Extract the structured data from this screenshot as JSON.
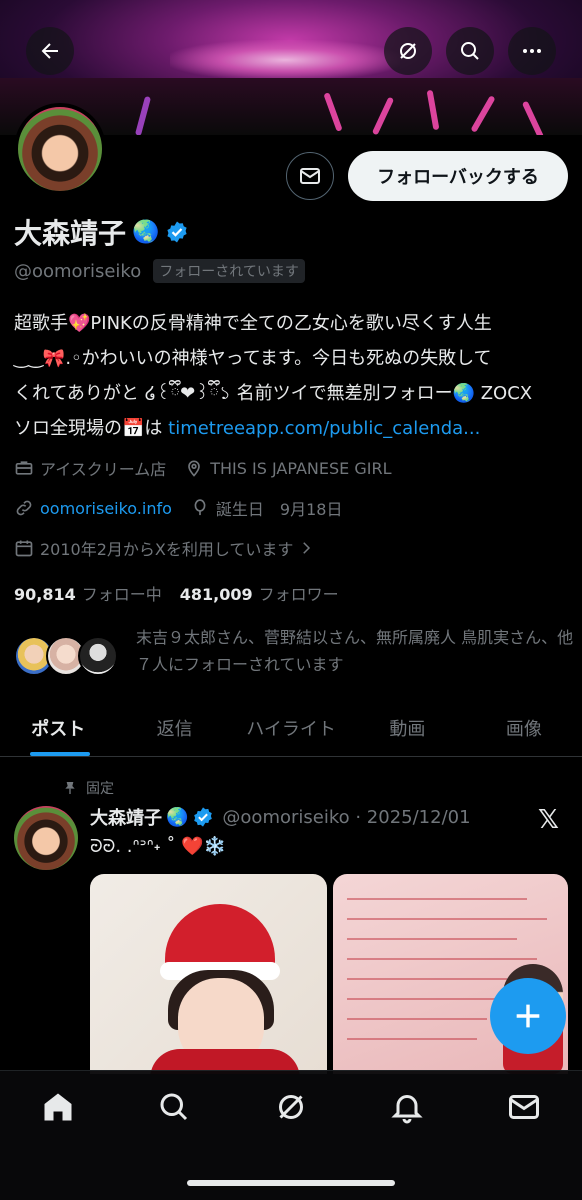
{
  "header": {
    "back_icon": "arrow-left-icon",
    "grok_icon": "grok-icon",
    "search_icon": "search-icon",
    "more_icon": "more-horizontal-icon"
  },
  "profile": {
    "name": "大森靖子",
    "name_emoji": "🌏",
    "handle": "@oomoriseiko",
    "follows_you": "フォローされています",
    "follow_back_label": "フォローバックする",
    "bio_line1": "超歌手💖PINKの反骨精神で全ての乙女心を歌い尽くす人生",
    "bio_line2": "‿‿🎀.◦かわいいの神様ヤってます。今日も死ぬの失敗して",
    "bio_line3": "くれてありがと ໒꒰ྀི❤︎꒱ྀི১ 名前ツイで無差別フォロー🌏 ZOCX",
    "bio_line4_text": "ソロ全現場の📅は ",
    "bio_line4_link": "timetreeapp.com/public_calenda...",
    "category": "アイスクリーム店",
    "location": "THIS IS JAPANESE GIRL",
    "website": "oomoriseiko.info",
    "birthday": "誕生日　9月18日",
    "joined": "2010年2月からXを利用しています",
    "following_count": "90,814",
    "following_label": "フォロー中",
    "followers_count": "481,009",
    "followers_label": "フォロワー",
    "known_followers": "末吉９太郎さん、菅野結以さん、無所属廃人 鳥肌実さん、他７人にフォローされています"
  },
  "tabs": [
    {
      "label": "ポスト",
      "active": true
    },
    {
      "label": "返信",
      "active": false
    },
    {
      "label": "ハイライト",
      "active": false
    },
    {
      "label": "動画",
      "active": false
    },
    {
      "label": "画像",
      "active": false
    }
  ],
  "pinned_post": {
    "pinned_label": "固定",
    "author_name": "大森靖子",
    "author_emoji": "🌏",
    "meta": "@oomoriseiko · 2025/12/01",
    "text": "ᘒᘒ. .ᐢᐣᐢ˖ ˚ ❤️❄️"
  },
  "colors": {
    "accent": "#1d9bf0",
    "background": "#000000",
    "text": "#e7e9ea",
    "muted": "#71767b"
  },
  "bottom_nav": [
    "home-icon",
    "search-icon",
    "grok-icon",
    "notifications-icon",
    "messages-icon"
  ]
}
